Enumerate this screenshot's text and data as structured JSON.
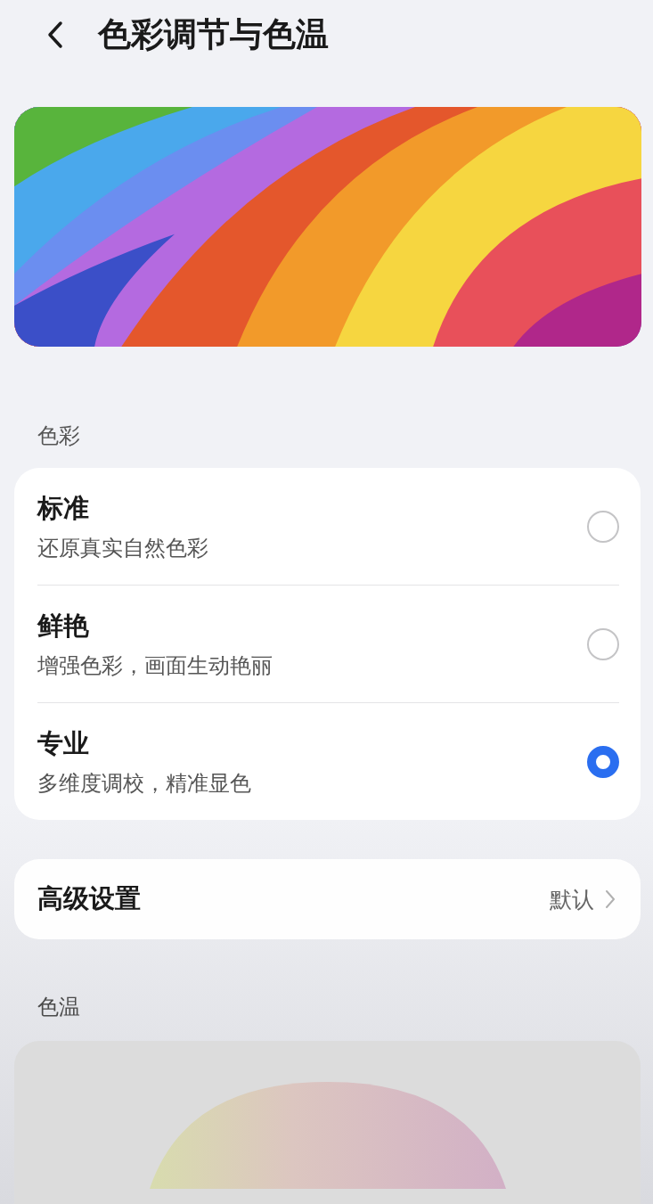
{
  "header": {
    "title": "色彩调节与色温"
  },
  "color_section": {
    "label": "色彩",
    "options": [
      {
        "title": "标准",
        "subtitle": "还原真实自然色彩",
        "selected": false
      },
      {
        "title": "鲜艳",
        "subtitle": "增强色彩，画面生动艳丽",
        "selected": false
      },
      {
        "title": "专业",
        "subtitle": "多维度调校，精准显色",
        "selected": true
      }
    ]
  },
  "advanced": {
    "label": "高级设置",
    "value": "默认"
  },
  "temperature_section": {
    "label": "色温"
  }
}
